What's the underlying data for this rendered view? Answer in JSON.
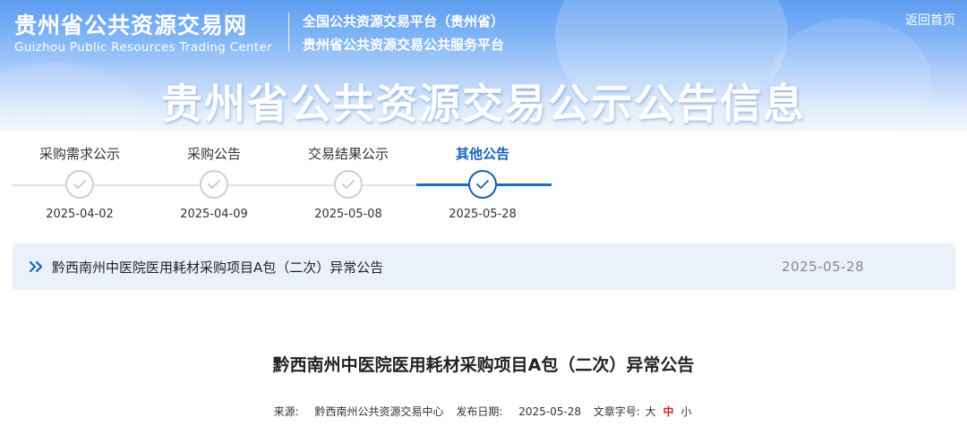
{
  "header": {
    "site_name_cn": "贵州省公共资源交易网",
    "site_name_en": "Guizhou Public Resources Trading Center",
    "platform_line1": "全国公共资源交易平台（贵州省）",
    "platform_line2": "贵州省公共资源交易公共服务平台",
    "home_link": "返回首页",
    "banner_title": "贵州省公共资源交易公示公告信息"
  },
  "steps": [
    {
      "label": "采购需求公示",
      "date": "2025-04-02",
      "active": false
    },
    {
      "label": "采购公告",
      "date": "2025-04-09",
      "active": false
    },
    {
      "label": "交易结果公示",
      "date": "2025-05-08",
      "active": false
    },
    {
      "label": "其他公告",
      "date": "2025-05-28",
      "active": true
    }
  ],
  "notice": {
    "icon": "double-chevron-right-icon",
    "title": "黔西南州中医院医用耗材采购项目A包（二次）异常公告",
    "date": "2025-05-28"
  },
  "article": {
    "title": "黔西南州中医院医用耗材采购项目A包（二次）异常公告",
    "source_label": "来源:",
    "source_value": "黔西南州公共资源交易中心",
    "publish_date_label": "发布日期:",
    "publish_date_value": "2025-05-28",
    "font_size_label": "文章字号:",
    "font_sizes": [
      "大",
      "中",
      "小"
    ],
    "font_size_selected": "中"
  },
  "colors": {
    "banner_blue": "#5e9cf0",
    "active_step": "#1a62b8",
    "notice_bg": "#eaf1fb",
    "selected_font_size": "#e02222"
  }
}
